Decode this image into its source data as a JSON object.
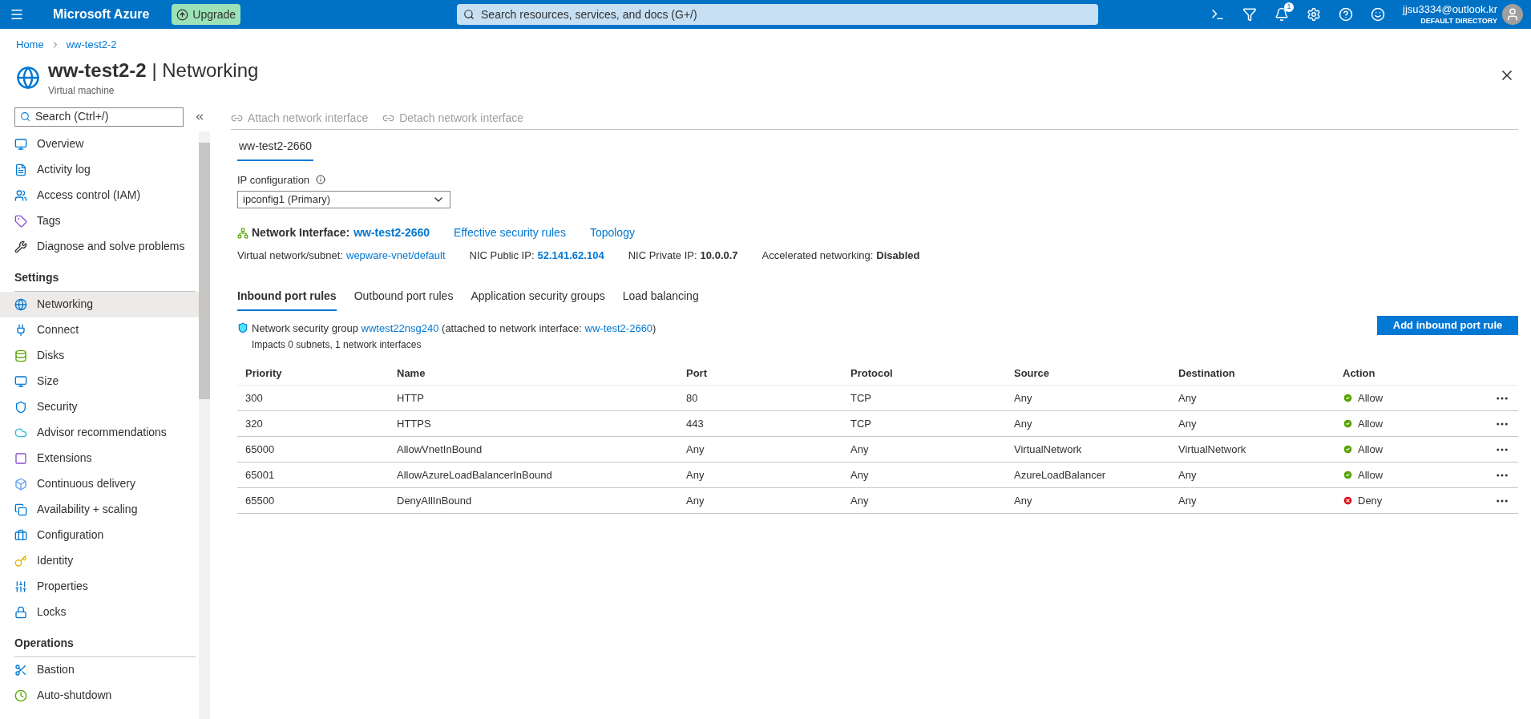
{
  "top_bar": {
    "brand": "Microsoft Azure",
    "upgrade_button": "Upgrade",
    "search_placeholder": "Search resources, services, and docs (G+/)",
    "notification_count": "1",
    "account_email": "jjsu3334@outlook.kr",
    "account_directory": "DEFAULT DIRECTORY"
  },
  "breadcrumb": [
    "Home",
    "ww-test2-2"
  ],
  "header": {
    "resource": "ww-test2-2",
    "section": "| Networking",
    "subtitle": "Virtual machine"
  },
  "sidebar": {
    "search_placeholder": "Search (Ctrl+/)",
    "sections": [
      {
        "items": [
          {
            "label": "Overview",
            "selected": false
          },
          {
            "label": "Activity log",
            "selected": false
          },
          {
            "label": "Access control (IAM)",
            "selected": false
          },
          {
            "label": "Tags",
            "selected": false
          },
          {
            "label": "Diagnose and solve problems",
            "selected": false
          }
        ]
      },
      {
        "heading": "Settings",
        "items": [
          {
            "label": "Networking",
            "selected": true
          },
          {
            "label": "Connect",
            "selected": false
          },
          {
            "label": "Disks",
            "selected": false
          },
          {
            "label": "Size",
            "selected": false
          },
          {
            "label": "Security",
            "selected": false
          },
          {
            "label": "Advisor recommendations",
            "selected": false
          },
          {
            "label": "Extensions",
            "selected": false
          },
          {
            "label": "Continuous delivery",
            "selected": false
          },
          {
            "label": "Availability + scaling",
            "selected": false
          },
          {
            "label": "Configuration",
            "selected": false
          },
          {
            "label": "Identity",
            "selected": false
          },
          {
            "label": "Properties",
            "selected": false
          },
          {
            "label": "Locks",
            "selected": false
          }
        ]
      },
      {
        "heading": "Operations",
        "items": [
          {
            "label": "Bastion",
            "selected": false
          },
          {
            "label": "Auto-shutdown",
            "selected": false
          }
        ]
      }
    ]
  },
  "toolbar": [
    {
      "label": "Attach network interface",
      "disabled": true
    },
    {
      "label": "Detach network interface",
      "disabled": true
    }
  ],
  "nic_tabs": [
    {
      "label": "ww-test2-2660",
      "selected": true
    }
  ],
  "ip_configuration": {
    "label": "IP configuration",
    "value": "ipconfig1 (Primary)"
  },
  "network_interface": {
    "label": "Network Interface:",
    "name": "ww-test2-2660",
    "links": [
      "Effective security rules",
      "Topology"
    ]
  },
  "details": [
    {
      "label": "Virtual network/subnet:",
      "value": "wepware-vnet/default",
      "kind": "link"
    },
    {
      "label": "NIC Public IP:",
      "value": "52.141.62.104",
      "kind": "boldlink"
    },
    {
      "label": "NIC Private IP:",
      "value": "10.0.0.7",
      "kind": "bold"
    },
    {
      "label": "Accelerated networking:",
      "value": "Disabled",
      "kind": "bold"
    }
  ],
  "rule_tabs": [
    {
      "label": "Inbound port rules",
      "selected": true
    },
    {
      "label": "Outbound port rules",
      "selected": false
    },
    {
      "label": "Application security groups",
      "selected": false
    },
    {
      "label": "Load balancing",
      "selected": false
    }
  ],
  "nsg": {
    "prefix": "Network security group",
    "name": "wwtest22nsg240",
    "middle": "(attached to network interface:",
    "nic": "ww-test2-2660",
    "suffix": ")",
    "impacts": "Impacts 0 subnets, 1 network interfaces"
  },
  "add_button": "Add inbound port rule",
  "table": {
    "columns": [
      "Priority",
      "Name",
      "Port",
      "Protocol",
      "Source",
      "Destination",
      "Action"
    ],
    "rows": [
      {
        "priority": "300",
        "name": "HTTP",
        "port": "80",
        "protocol": "TCP",
        "source": "Any",
        "destination": "Any",
        "action": {
          "label": "Allow",
          "kind": "allow"
        }
      },
      {
        "priority": "320",
        "name": "HTTPS",
        "port": "443",
        "protocol": "TCP",
        "source": "Any",
        "destination": "Any",
        "action": {
          "label": "Allow",
          "kind": "allow"
        }
      },
      {
        "priority": "65000",
        "name": "AllowVnetInBound",
        "port": "Any",
        "protocol": "Any",
        "source": "VirtualNetwork",
        "destination": "VirtualNetwork",
        "action": {
          "label": "Allow",
          "kind": "allow"
        }
      },
      {
        "priority": "65001",
        "name": "AllowAzureLoadBalancerInBound",
        "port": "Any",
        "protocol": "Any",
        "source": "AzureLoadBalancer",
        "destination": "Any",
        "action": {
          "label": "Allow",
          "kind": "allow"
        }
      },
      {
        "priority": "65500",
        "name": "DenyAllInBound",
        "port": "Any",
        "protocol": "Any",
        "source": "Any",
        "destination": "Any",
        "action": {
          "label": "Deny",
          "kind": "deny"
        }
      }
    ]
  }
}
